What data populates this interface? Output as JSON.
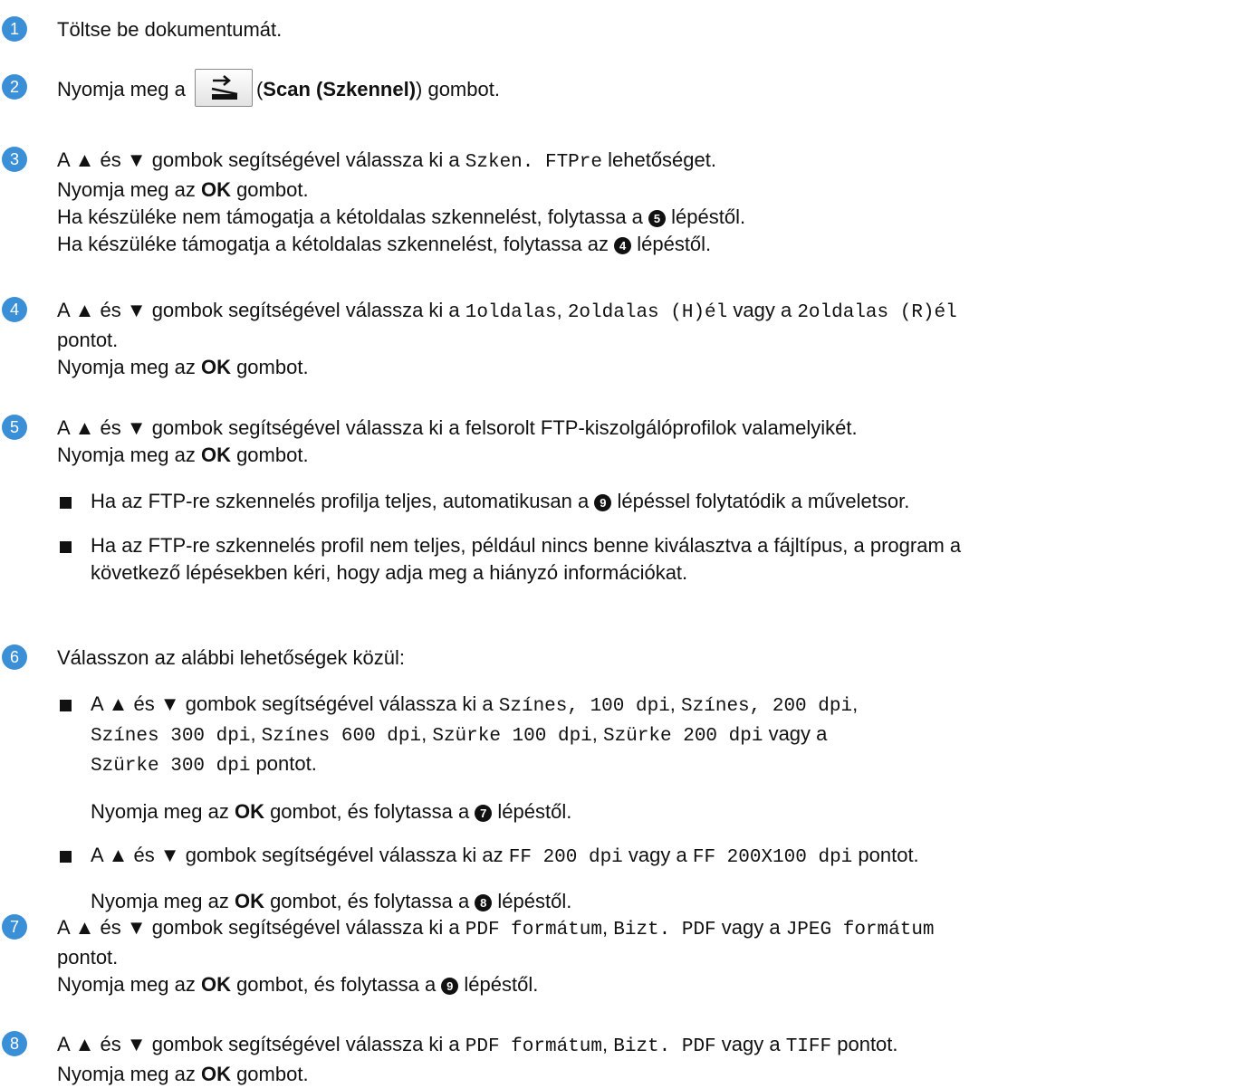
{
  "steps": [
    {
      "number": "1",
      "line1": "Töltse be dokumentumát."
    },
    {
      "number": "2",
      "line1_a": "Nyomja meg a",
      "line1_b": "(",
      "button": "Scan (Szkennel)",
      "line1_c": ") gombot."
    },
    {
      "number": "3",
      "line1_a": "A ▲ és ▼ gombok segítségével válassza ki a ",
      "line1_mono": "Szken. FTPre",
      "line1_b": " lehetőséget.",
      "line2_a": "Nyomja meg az ",
      "line2_ok": "OK",
      "line2_b": " gombot.",
      "line3_a": "Ha készüléke nem támogatja a kétoldalas szkennelést, folytassa a ",
      "line3_mark": "5",
      "line3_b": " lépéstől.",
      "line4_a": "Ha készüléke támogatja a kétoldalas szkennelést, folytassa az ",
      "line4_mark": "4",
      "line4_b": " lépéstől."
    },
    {
      "number": "4",
      "line1_a": "A ▲ és ▼ gombok segítségével válassza ki a ",
      "line1_m1": "1oldalas",
      "line1_sep": ", ",
      "line1_m2": "2oldalas (H)él",
      "line1_or": " vagy a ",
      "line1_m3": "2oldalas (R)él",
      "line2": "pontot.",
      "line3_a": "Nyomja meg az ",
      "line3_ok": "OK",
      "line3_b": " gombot."
    },
    {
      "number": "5",
      "line1": "A ▲ és ▼ gombok segítségével válassza ki a felsorolt FTP-kiszolgálóprofilok valamelyikét.",
      "line2_a": "Nyomja meg az ",
      "line2_ok": "OK",
      "line2_b": " gombot.",
      "bullet1_a": "Ha az FTP-re szkennelés profilja teljes, automatikusan a ",
      "bullet1_mark": "9",
      "bullet1_b": " lépéssel folytatódik a műveletsor.",
      "bullet2_l1": "Ha az FTP-re szkennelés profil nem teljes, például nincs benne kiválasztva a fájltípus, a program a",
      "bullet2_l2": "következő lépésekben kéri, hogy adja meg a hiányzó információkat."
    },
    {
      "number": "6",
      "line1": "Válasszon az alábbi lehetőségek közül:",
      "b1_a": "A ▲ és ▼ gombok segítségével válassza ki a ",
      "b1_m1": "Színes, 100 dpi",
      "b1_s1": ", ",
      "b1_m2": "Színes, 200 dpi",
      "b1_s2": ",",
      "b1_m3": "Színes 300 dpi",
      "b1_s3": ", ",
      "b1_m4": "Színes 600 dpi",
      "b1_s4": ", ",
      "b1_m5": "Szürke 100 dpi",
      "b1_s5": ", ",
      "b1_m6": "Szürke 200 dpi",
      "b1_or": " vagy a",
      "b1_m7": "Szürke 300 dpi",
      "b1_end": " pontot.",
      "b1_ok_a": "Nyomja meg az ",
      "b1_ok": "OK",
      "b1_ok_b": " gombot, és folytassa a ",
      "b1_mark": "7",
      "b1_ok_c": " lépéstől.",
      "b2_a": "A ▲ és ▼ gombok segítségével válassza ki az ",
      "b2_m1": "FF 200 dpi",
      "b2_or": " vagy a ",
      "b2_m2": "FF 200X100 dpi",
      "b2_end": " pontot.",
      "b2_ok_a": "Nyomja meg az ",
      "b2_ok": "OK",
      "b2_ok_b": " gombot, és folytassa a ",
      "b2_mark": "8",
      "b2_ok_c": " lépéstől."
    },
    {
      "number": "7",
      "line1_a": "A ▲ és ▼ gombok segítségével válassza ki a ",
      "line1_m1": "PDF formátum",
      "line1_sep": ", ",
      "line1_m2": "Bizt. PDF",
      "line1_or": " vagy a ",
      "line1_m3": "JPEG formátum",
      "line2": "pontot.",
      "line3_a": "Nyomja meg az ",
      "line3_ok": "OK",
      "line3_b": " gombot, és folytassa a ",
      "line3_mark": "9",
      "line3_c": " lépéstől."
    },
    {
      "number": "8",
      "line1_a": "A ▲ és ▼ gombok segítségével válassza ki a ",
      "line1_m1": "PDF formátum",
      "line1_sep": ", ",
      "line1_m2": "Bizt. PDF",
      "line1_or": " vagy a ",
      "line1_m3": "TIFF",
      "line1_end": " pontot.",
      "line2_a": "Nyomja meg az ",
      "line2_ok": "OK",
      "line2_b": " gombot."
    }
  ],
  "colors": {
    "step_circle": "#3a8fd6"
  },
  "icons": {
    "scan_button": "scan-icon"
  }
}
